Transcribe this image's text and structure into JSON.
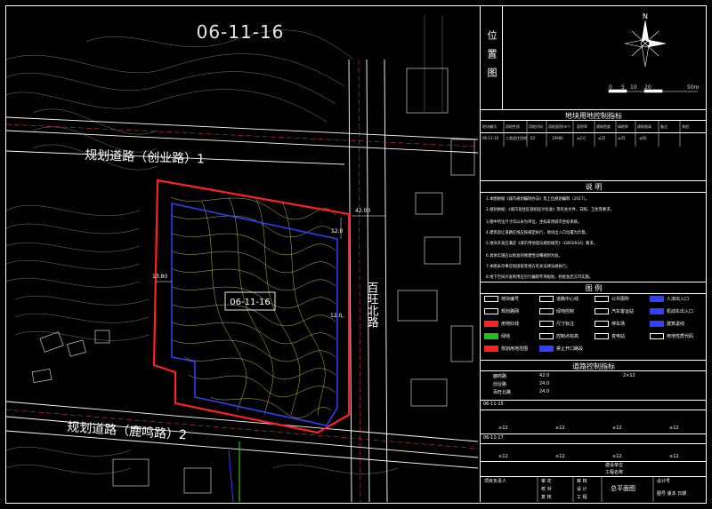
{
  "plot_code_title": "06-11-16",
  "plot_label_center": "06-11-16",
  "roads": {
    "upper": "规划道路（创业路）1",
    "lower": "规划道路（鹿鸣路）2",
    "east": "百旺北路"
  },
  "dimensions": {
    "road_width": "42.00",
    "setback_north": "12.0",
    "setback_east": "12.0",
    "setback_west": "13.80"
  },
  "panel": {
    "location_label": "位置图",
    "scale_ticks": [
      "0",
      "5",
      "10",
      "20",
      "50m"
    ],
    "compass_n": "N",
    "control_table_title": "地块用地控制指标",
    "control_table_header": [
      "地块编号",
      "用地性质",
      "用地代码",
      "用地面积(m²)",
      "容积率",
      "建筑密度",
      "绿地率",
      "建筑限高",
      "备注",
      "其他"
    ],
    "control_table_row": [
      "06-11-16",
      "二类居住用地",
      "R2",
      "19986",
      "≤2.0",
      "≤25",
      "≥35",
      "≤60",
      "",
      ""
    ],
    "notes_title": "说  明",
    "notes": [
      "1.本图依据《城市规划编制办法》及上位规划编制（2017）。",
      "2.规划依据：《城市居住区规划设计标准》等有关文件、日照、卫生等要求。",
      "3.图中所注尺寸均以米为单位，坐标采用城市坐标系统。",
      "4.建筑退让道路红线应按规定执行，地块出入口位置为示意。",
      "5.地块开发应满足《城市用地竖向规划规范》（GB50016）要求。",
      "6.具体实施应以批准的修建性详细规划为准。",
      "7.本图未尽事宜按国家及地方有关法律法规执行。",
      "8.地下空间开发利用应另行编制专项规划，经批准后方可实施。"
    ],
    "legend_title": "图  例",
    "legend": [
      {
        "label": "地块编号",
        "color": "#ffffff"
      },
      {
        "label": "道路中心线",
        "color": "#ffffff"
      },
      {
        "label": "公共厕所",
        "color": "#ffffff"
      },
      {
        "label": "人流出入口",
        "color": "#3040ff"
      },
      {
        "label": "规划路网",
        "color": "#ffffff"
      },
      {
        "label": "绿地控制",
        "color": "#ffffff"
      },
      {
        "label": "汽车客运站",
        "color": "#ffffff"
      },
      {
        "label": "机动车出入口",
        "color": "#3040ff"
      },
      {
        "label": "用地红线",
        "color": "#ff2020"
      },
      {
        "label": "尺寸标注",
        "color": "#ffffff"
      },
      {
        "label": "停车场",
        "color": "#ffffff"
      },
      {
        "label": "建筑退线",
        "color": "#3040ff"
      },
      {
        "label": "绿线",
        "color": "#20c020"
      },
      {
        "label": "控制点标高",
        "color": "#ffffff"
      },
      {
        "label": "变电站",
        "color": "#ffffff"
      },
      {
        "label": "用地性质代码",
        "color": "#ffffff"
      },
      {
        "label": "规划用地范围",
        "color": "#ff2020"
      },
      {
        "label": "禁止开口路段",
        "color": "#3040ff"
      }
    ],
    "road_table_title": "道路控制指标",
    "road_rows": [
      {
        "name": "鹿鸣路",
        "a": "42.0",
        "b": "2×12"
      },
      {
        "name": "创业路",
        "a": "24.0",
        "b": ""
      },
      {
        "name": "百旺北路",
        "a": "24.0",
        "b": ""
      }
    ],
    "block_a_label": "06-11-15",
    "block_b_label": "06-11-17",
    "block_cells": [
      "≥12",
      "≥12",
      "≥12",
      "≥12",
      "≥12",
      "≥12",
      "≥12",
      "≥12"
    ],
    "footer": {
      "project_label": "项目负责人",
      "design_unit": "建设单位",
      "project_name": "工程名称",
      "drawing_name": "总平面图",
      "rows": [
        [
          "审 定",
          "审 核"
        ],
        [
          "校 对",
          "设 计"
        ],
        [
          "复 核",
          "工 程"
        ],
        [
          "制 图",
          "专 业"
        ]
      ],
      "right_rows": [
        "设计号",
        "图号  版本  日期"
      ]
    }
  }
}
